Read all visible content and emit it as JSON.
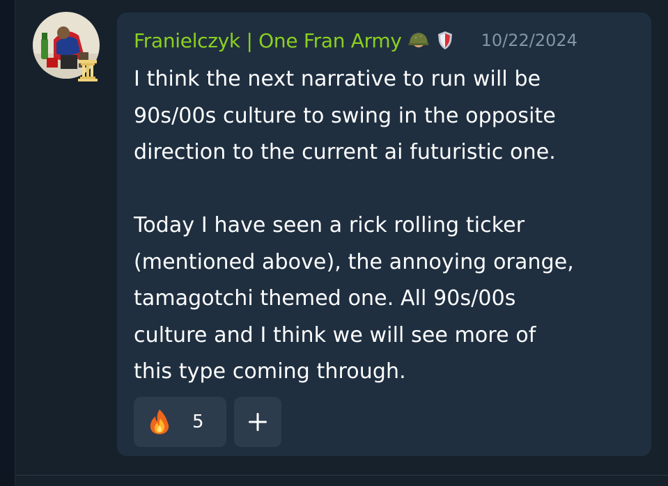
{
  "message": {
    "author": "Franielczyk | One Fran Army",
    "author_badges": [
      "helmet-icon",
      "shield-icon"
    ],
    "timestamp": "10/22/2024",
    "paragraphs": [
      "I think the next narrative to run will be\n90s/00s culture to swing in the opposite\ndirection to the current ai futuristic one.",
      "Today I have seen a rick rolling ticker\n(mentioned above), the annoying orange,\ntamagotchi themed one. All 90s/00s\nculture and I think we will see more of\nthis type coming through."
    ],
    "reactions": [
      {
        "icon": "fire-icon",
        "count": "5"
      }
    ],
    "add_reaction_icon": "plus-icon"
  },
  "colors": {
    "page_bg": "#17212b",
    "bubble_bg": "#1f2f40",
    "author": "#8bd11e",
    "timestamp": "#8396a8",
    "text": "#ffffff",
    "reaction_bg": "#2c3c4d"
  }
}
